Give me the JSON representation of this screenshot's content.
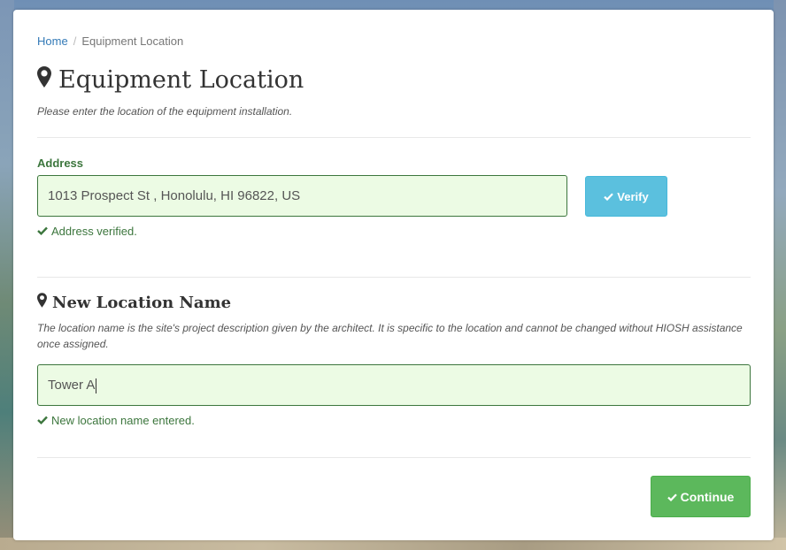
{
  "breadcrumb": {
    "home": "Home",
    "separator": "/",
    "current": "Equipment Location"
  },
  "page": {
    "title": "Equipment Location",
    "subtitle": "Please enter the location of the equipment installation."
  },
  "address": {
    "label": "Address",
    "value": "1013 Prospect St , Honolulu, HI 96822, US",
    "verify_label": "Verify",
    "status": "Address verified."
  },
  "location_name": {
    "heading": "New Location Name",
    "description": "The location name is the site's project description given by the architect. It is specific to the location and cannot be changed without HIOSH assistance once assigned.",
    "value": "Tower A",
    "status": "New location name entered."
  },
  "actions": {
    "continue_label": "Continue"
  },
  "colors": {
    "success": "#3c763d",
    "info_button": "#5bc0de",
    "success_button": "#5cb85c",
    "link": "#337ab7"
  },
  "icons": {
    "location": "map-marker-icon",
    "check": "check-icon"
  }
}
